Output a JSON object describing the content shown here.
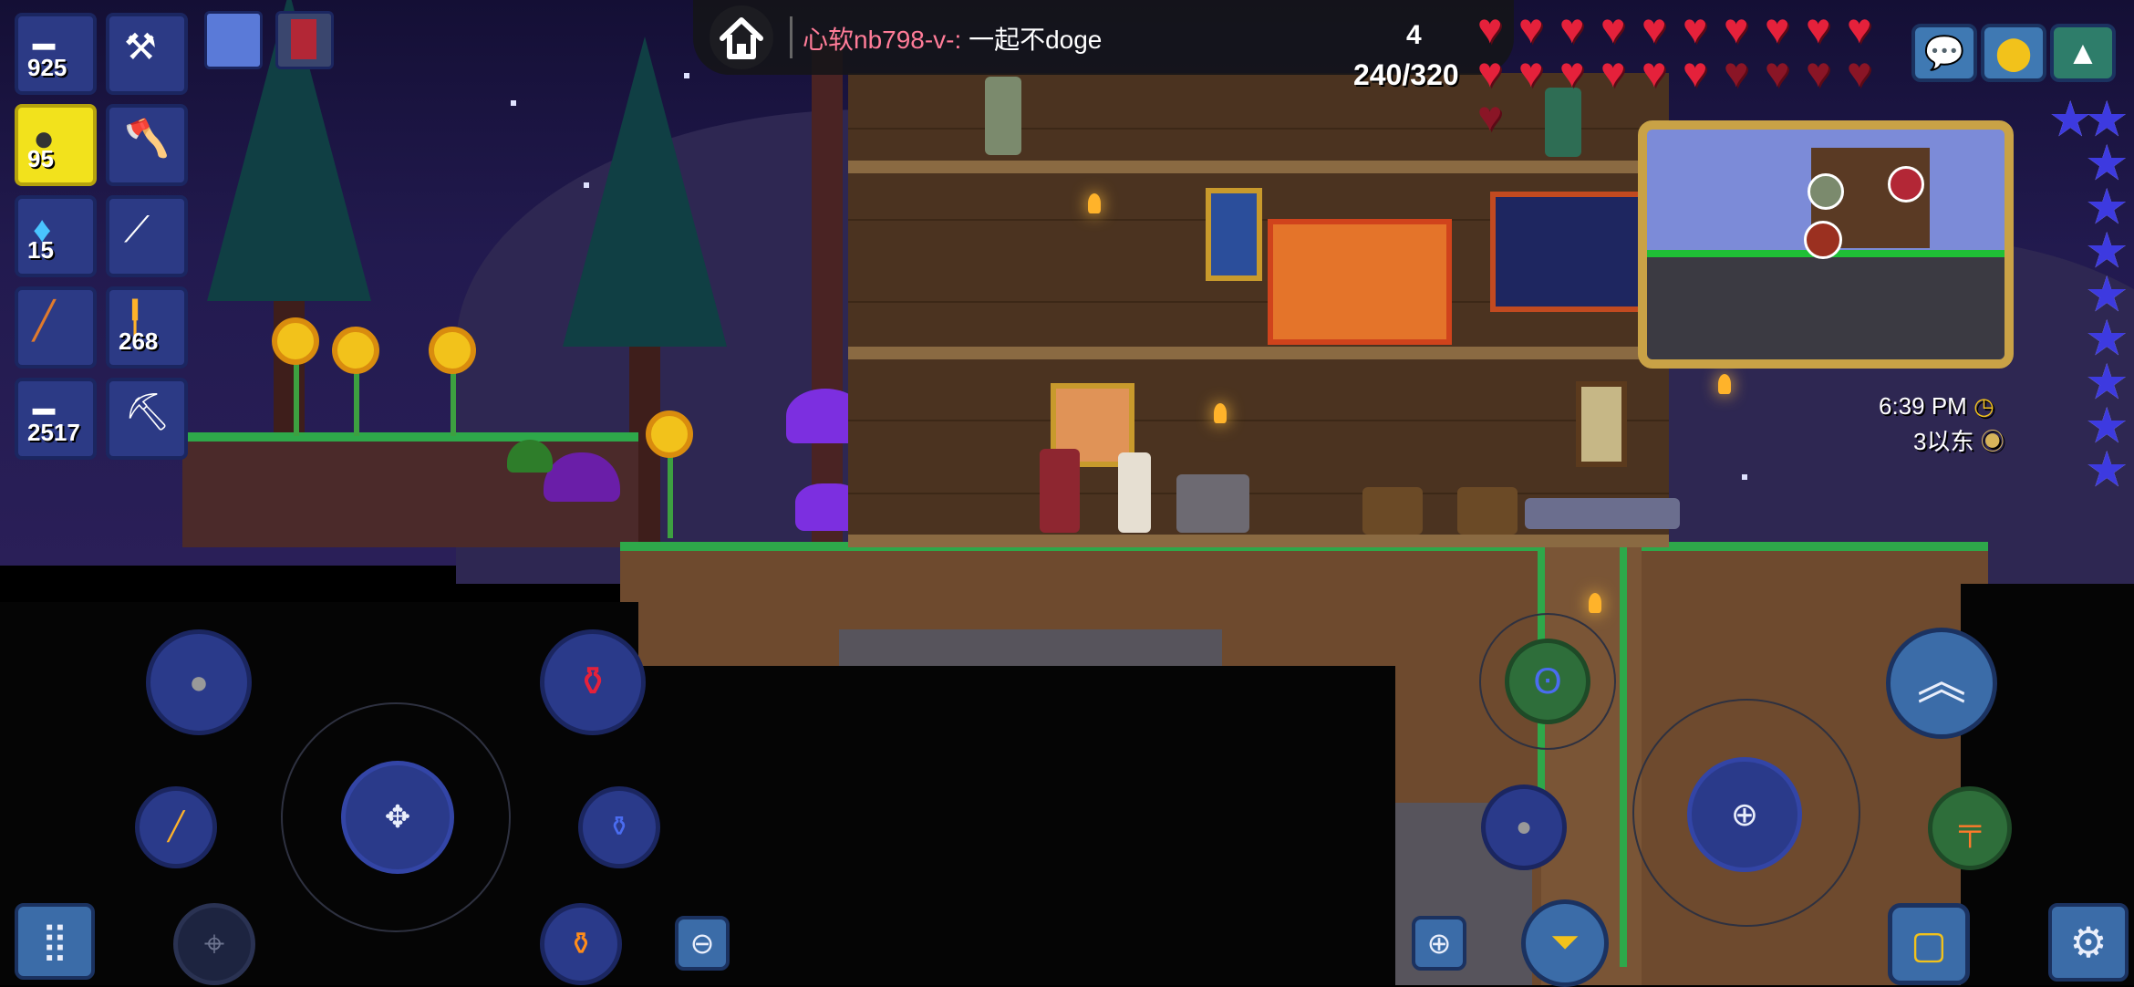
{
  "hotbar": {
    "items": [
      {
        "icon": "musket-icon",
        "count": "925"
      },
      {
        "icon": "hammer-icon",
        "count": ""
      },
      {
        "icon": "bomb-icon",
        "count": "95",
        "selected": true
      },
      {
        "icon": "axe-icon",
        "count": ""
      },
      {
        "icon": "mana-potion-icon",
        "count": "15"
      },
      {
        "icon": "shovel-icon",
        "count": ""
      },
      {
        "icon": "staff-icon",
        "count": ""
      },
      {
        "icon": "torch-icon",
        "count": "268"
      },
      {
        "icon": "musket-ball-icon",
        "count": "2517"
      },
      {
        "icon": "pickaxe-icon",
        "count": ""
      }
    ]
  },
  "buffs": [
    "moon-buff-icon",
    "banner-buff-icon"
  ],
  "chat": {
    "name": "心软nb798-v-:",
    "message": " 一起不doge"
  },
  "status": {
    "defense": "4",
    "life": "240/320"
  },
  "hearts": {
    "full": 16,
    "empty": 5
  },
  "mana": {
    "stars": 10
  },
  "clock": {
    "time": "6:39 PM",
    "position": "3以东"
  },
  "colors": {
    "heart": "#e5213b",
    "mana": "#3d3ae0",
    "selected_slot": "#f2e21c",
    "slot": "#2c3a85",
    "chat_name": "#ff7c98",
    "minimap_frame": "#c9a246"
  }
}
